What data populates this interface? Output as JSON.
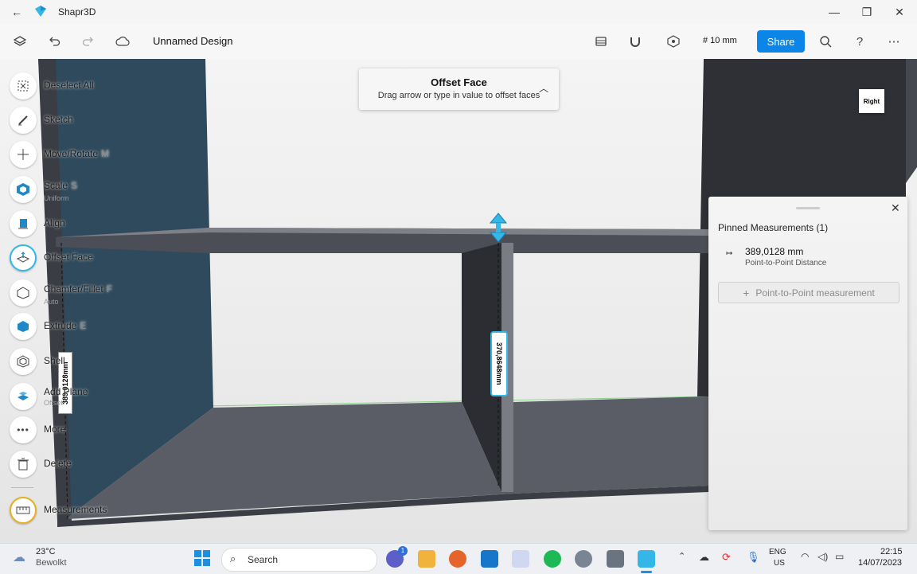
{
  "window": {
    "app_title": "Shapr3D",
    "controls": [
      "—",
      "❐",
      "✕"
    ]
  },
  "toolbar": {
    "design_name": "Unnamed Design",
    "grid_size": "# 10 mm",
    "share_label": "Share"
  },
  "sidebar": {
    "tools": [
      {
        "label": "Deselect All",
        "shortcut": "",
        "sub": ""
      },
      {
        "label": "Sketch",
        "shortcut": "",
        "sub": ""
      },
      {
        "label": "Move/Rotate",
        "shortcut": "M",
        "sub": ""
      },
      {
        "label": "Scale",
        "shortcut": "S",
        "sub": "Uniform"
      },
      {
        "label": "Align",
        "shortcut": "",
        "sub": ""
      },
      {
        "label": "Offset Face",
        "shortcut": "",
        "sub": ""
      },
      {
        "label": "Chamfer/Fillet",
        "shortcut": "F",
        "sub": "Auto"
      },
      {
        "label": "Extrude",
        "shortcut": "E",
        "sub": ""
      },
      {
        "label": "Shell",
        "shortcut": "",
        "sub": ""
      },
      {
        "label": "Add Plane",
        "shortcut": "",
        "sub": "Offset"
      },
      {
        "label": "More",
        "shortcut": "",
        "sub": ""
      },
      {
        "label": "Delete",
        "shortcut": "",
        "sub": ""
      },
      {
        "label": "Measurements",
        "shortcut": "",
        "sub": ""
      }
    ]
  },
  "offset_card": {
    "title": "Offset Face",
    "subtitle": "Drag arrow or type in value to offset faces"
  },
  "view_cube": {
    "label": "Right"
  },
  "dimensions": {
    "left_label": "389,0128mm",
    "center_label": "370,8648mm"
  },
  "pinned": {
    "title": "Pinned Measurements (1)",
    "item_value": "389,0128 mm",
    "item_type": "Point-to-Point Distance",
    "add_label": "Point-to-Point measurement"
  },
  "taskbar": {
    "weather_temp": "23°C",
    "weather_desc": "Bewolkt",
    "search_label": "Search",
    "chat_badge": "1",
    "lang_top": "ENG",
    "lang_bottom": "US",
    "time": "22:15",
    "date": "14/07/2023"
  },
  "colors": {
    "accent": "#0b86e8",
    "panel_dark": "#3a3d44",
    "panel_side": "#2f4a5c"
  }
}
